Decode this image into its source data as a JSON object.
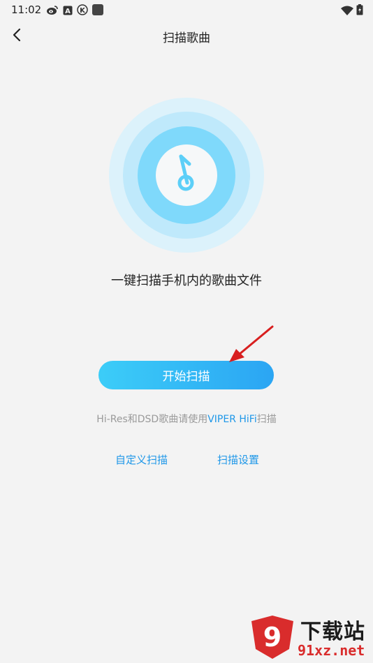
{
  "status_bar": {
    "time": "11:02",
    "left_icons": [
      "weibo-icon",
      "a-badge-icon",
      "k-badge-icon",
      "app-square-icon"
    ],
    "right_icons": [
      "wifi-icon",
      "battery-icon"
    ]
  },
  "header": {
    "title": "扫描歌曲",
    "back_icon": "chevron-left-icon"
  },
  "main": {
    "graphic_icon": "music-note-icon",
    "tagline": "一键扫描手机内的歌曲文件",
    "start_button_label": "开始扫描",
    "hint_prefix": "Hi-Res和DSD歌曲请使用",
    "hint_link": "VIPER HiFi",
    "hint_suffix": "扫描",
    "custom_scan_label": "自定义扫描",
    "scan_settings_label": "扫描设置"
  },
  "colors": {
    "accent": "#1e97e8",
    "button_gradient_start": "#3ccdf8",
    "button_gradient_end": "#2ba5f3",
    "ring_outer": "#dcf2fb",
    "ring_middle": "#bfe9fb",
    "ring_inner": "#7fd9fb",
    "note": "#5ccff8",
    "annotation_arrow": "#d81f1f"
  },
  "watermark": {
    "logo_text": "9",
    "top_text": "下载站",
    "bottom_text": "91xz.net"
  }
}
